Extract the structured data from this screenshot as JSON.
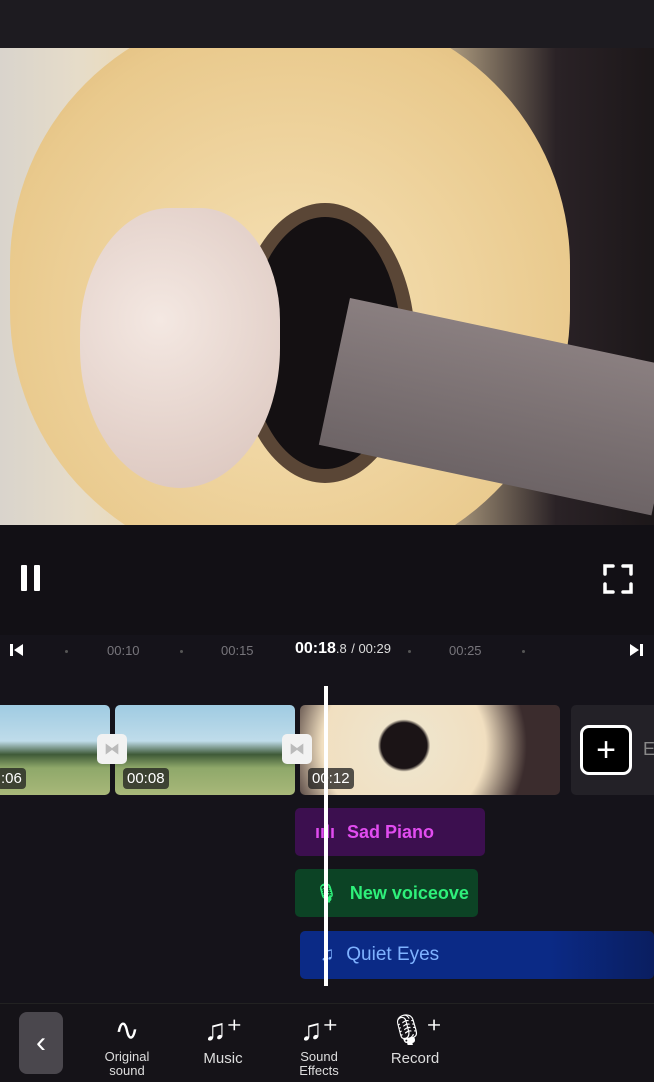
{
  "player": {
    "pause_icon": "pause-icon",
    "fullscreen_icon": "fullscreen-icon"
  },
  "ruler": {
    "ticks": [
      "00:10",
      "00:15",
      "00:25"
    ],
    "current_main": "00:18",
    "current_fraction": ".8",
    "total": "/ 00:29"
  },
  "clips": [
    {
      "time": ":06"
    },
    {
      "time": "00:08"
    },
    {
      "time": "00:12"
    }
  ],
  "add_label": "E",
  "tracks": {
    "sad_piano": "Sad Piano",
    "voiceover": "New voiceove",
    "quiet_eyes": "Quiet Eyes"
  },
  "colors": {
    "sad_piano_bg": "#3c0f4f",
    "sad_piano_text": "#e14cf0",
    "voiceover_bg": "#0c4325",
    "voiceover_text": "#2ef07a",
    "quiet_eyes_bg": "#0b2a86",
    "quiet_eyes_text": "#7fb2ff"
  },
  "toolbar": {
    "original_1": "Original",
    "original_2": "sound",
    "music": "Music",
    "sfx_1": "Sound",
    "sfx_2": "Effects",
    "record": "Record"
  }
}
